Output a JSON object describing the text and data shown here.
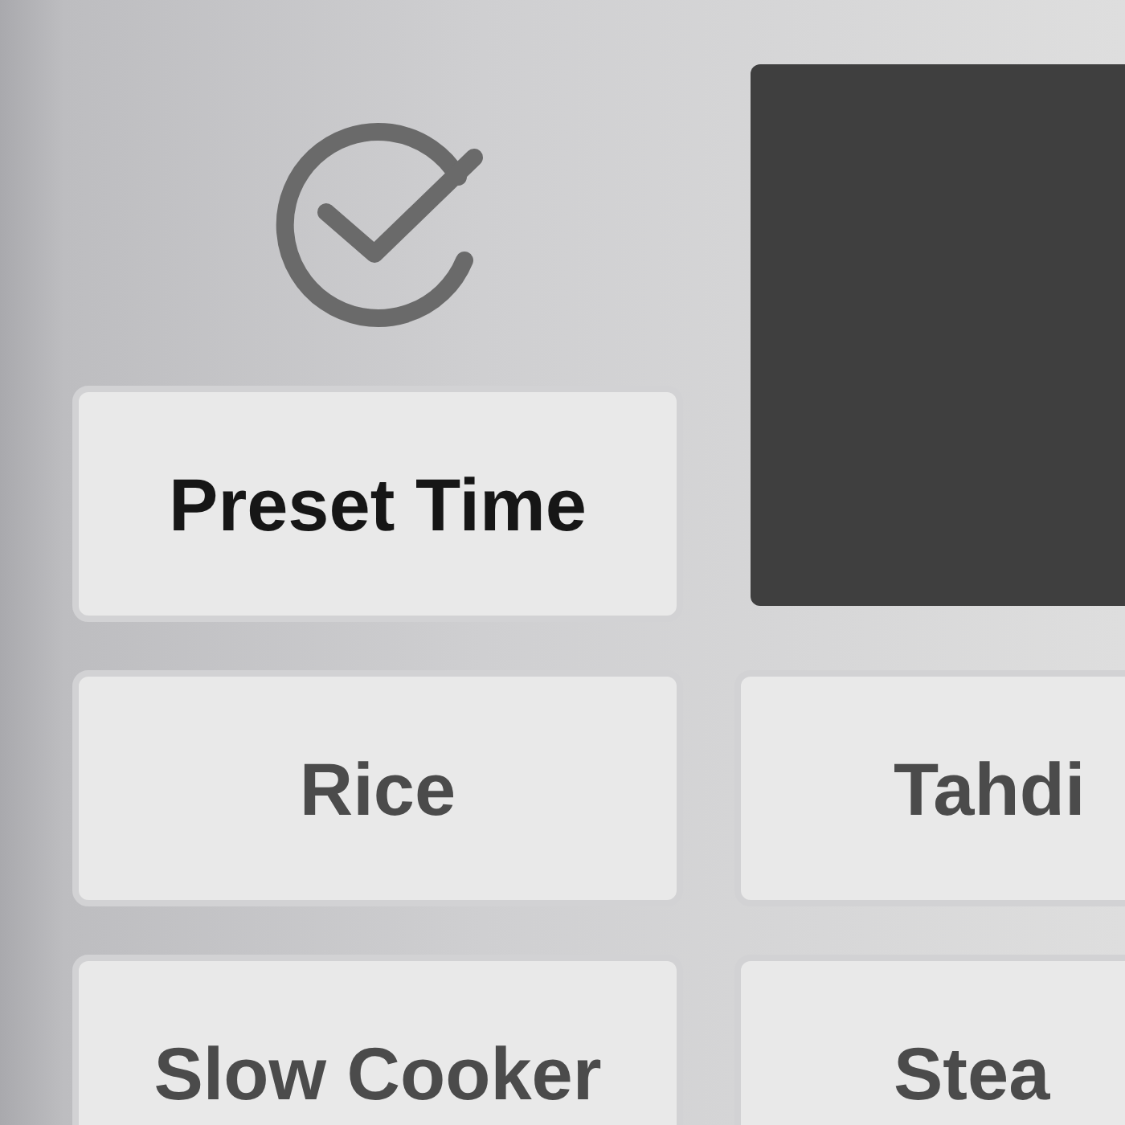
{
  "display": {
    "kind": "screen"
  },
  "buttons": [
    {
      "label": "Preset Time",
      "selected": true
    },
    {
      "label": "Rice",
      "selected": false
    },
    {
      "label": "Tahdi",
      "selected": false
    },
    {
      "label": "Slow Cooker",
      "selected": false
    },
    {
      "label": "Stea",
      "selected": false
    }
  ]
}
